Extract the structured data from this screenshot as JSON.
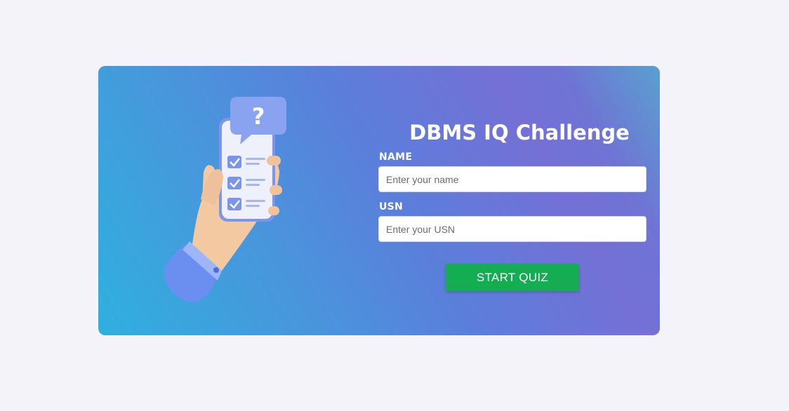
{
  "quiz": {
    "title": "DBMS IQ Challenge",
    "name_label": "NAME",
    "name_placeholder": "Enter your name",
    "usn_label": "USN",
    "usn_placeholder": "Enter your USN",
    "start_button": "START QUIZ"
  },
  "illustration": {
    "icon": "hand-holding-phone-checklist-icon",
    "bubble_glyph": "?"
  },
  "colors": {
    "page_background": "#f3f3f9",
    "card_gradient_start": "#2fb0de",
    "card_gradient_end": "#7470d6",
    "button": "#14ad51"
  }
}
